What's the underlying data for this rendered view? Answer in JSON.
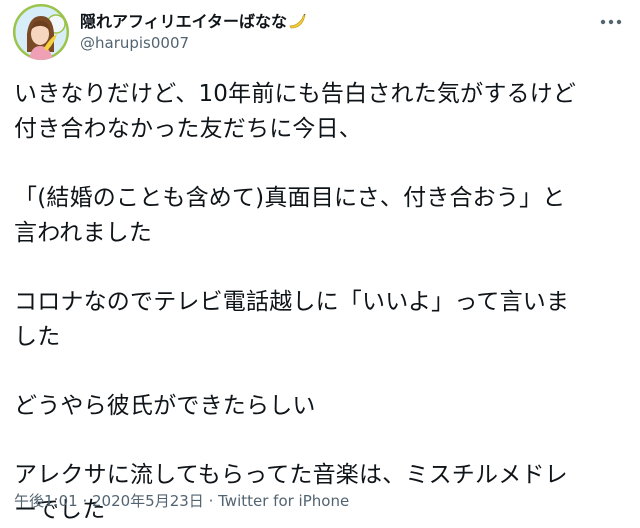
{
  "author": {
    "display_name": "隠れアフィリエイターばなな",
    "handle": "@harupis0007",
    "badge_icon": "banana-icon"
  },
  "tweet": {
    "paragraphs": [
      [
        "いきなりだけど、10年前にも告白された気がするけど",
        "付き合わなかった友だちに今日、"
      ],
      [
        "「(結婚のことも含めて)真面目にさ、付き合おう」と",
        "言われました"
      ],
      [
        "コロナなのでテレビ電話越しに「いいよ」って言いま",
        "した"
      ],
      [
        "どうやら彼氏ができたらしい"
      ],
      [
        "アレクサに流してもらってた音楽は、ミスチルメドレ",
        "ーでした"
      ]
    ]
  },
  "meta": {
    "time": "午後1:01",
    "separator1": " · ",
    "date": "2020年5月23日",
    "separator2": " · ",
    "source": "Twitter for iPhone"
  },
  "colors": {
    "text": "#0f1419",
    "secondary": "#536471",
    "avatar_ring": "#9cc34a",
    "banana": "#f4d03f"
  }
}
